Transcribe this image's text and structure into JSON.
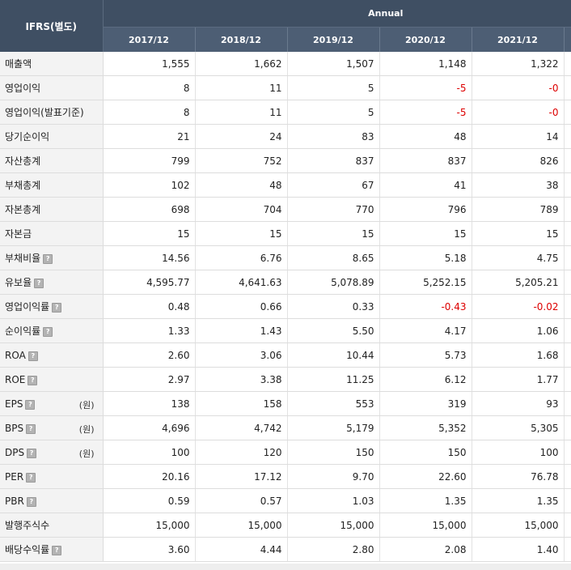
{
  "table": {
    "corner_label": "IFRS(별도)",
    "period_group": "Annual",
    "years": [
      "2017/12",
      "2018/12",
      "2019/12",
      "2020/12",
      "2021/12"
    ],
    "rows": [
      {
        "key": "revenue",
        "label": "매출액",
        "help": false,
        "unit": "",
        "values": [
          "1,555",
          "1,662",
          "1,507",
          "1,148",
          "1,322"
        ]
      },
      {
        "key": "operating-profit",
        "label": "영업이익",
        "help": false,
        "unit": "",
        "values": [
          "8",
          "11",
          "5",
          "-5",
          "-0"
        ]
      },
      {
        "key": "operating-profit-reported",
        "label": "영업이익(발표기준)",
        "help": false,
        "unit": "",
        "values": [
          "8",
          "11",
          "5",
          "-5",
          "-0"
        ]
      },
      {
        "key": "net-income",
        "label": "당기순이익",
        "help": false,
        "unit": "",
        "values": [
          "21",
          "24",
          "83",
          "48",
          "14"
        ]
      },
      {
        "key": "total-assets",
        "label": "자산총계",
        "help": false,
        "unit": "",
        "values": [
          "799",
          "752",
          "837",
          "837",
          "826"
        ]
      },
      {
        "key": "total-liabilities",
        "label": "부채총계",
        "help": false,
        "unit": "",
        "values": [
          "102",
          "48",
          "67",
          "41",
          "38"
        ]
      },
      {
        "key": "total-equity",
        "label": "자본총계",
        "help": false,
        "unit": "",
        "values": [
          "698",
          "704",
          "770",
          "796",
          "789"
        ]
      },
      {
        "key": "capital-stock",
        "label": "자본금",
        "help": false,
        "unit": "",
        "values": [
          "15",
          "15",
          "15",
          "15",
          "15"
        ]
      },
      {
        "key": "debt-ratio",
        "label": "부채비율",
        "help": true,
        "unit": "",
        "values": [
          "14.56",
          "6.76",
          "8.65",
          "5.18",
          "4.75"
        ]
      },
      {
        "key": "reserve-ratio",
        "label": "유보율",
        "help": true,
        "unit": "",
        "values": [
          "4,595.77",
          "4,641.63",
          "5,078.89",
          "5,252.15",
          "5,205.21"
        ]
      },
      {
        "key": "operating-margin",
        "label": "영업이익률",
        "help": true,
        "unit": "",
        "values": [
          "0.48",
          "0.66",
          "0.33",
          "-0.43",
          "-0.02"
        ]
      },
      {
        "key": "net-margin",
        "label": "순이익률",
        "help": true,
        "unit": "",
        "values": [
          "1.33",
          "1.43",
          "5.50",
          "4.17",
          "1.06"
        ]
      },
      {
        "key": "roa",
        "label": "ROA",
        "help": true,
        "unit": "",
        "values": [
          "2.60",
          "3.06",
          "10.44",
          "5.73",
          "1.68"
        ]
      },
      {
        "key": "roe",
        "label": "ROE",
        "help": true,
        "unit": "",
        "values": [
          "2.97",
          "3.38",
          "11.25",
          "6.12",
          "1.77"
        ]
      },
      {
        "key": "eps",
        "label": "EPS",
        "help": true,
        "unit": "(원)",
        "values": [
          "138",
          "158",
          "553",
          "319",
          "93"
        ]
      },
      {
        "key": "bps",
        "label": "BPS",
        "help": true,
        "unit": "(원)",
        "values": [
          "4,696",
          "4,742",
          "5,179",
          "5,352",
          "5,305"
        ]
      },
      {
        "key": "dps",
        "label": "DPS",
        "help": true,
        "unit": "(원)",
        "values": [
          "100",
          "120",
          "150",
          "150",
          "100"
        ]
      },
      {
        "key": "per",
        "label": "PER",
        "help": true,
        "unit": "",
        "values": [
          "20.16",
          "17.12",
          "9.70",
          "22.60",
          "76.78"
        ]
      },
      {
        "key": "pbr",
        "label": "PBR",
        "help": true,
        "unit": "",
        "values": [
          "0.59",
          "0.57",
          "1.03",
          "1.35",
          "1.35"
        ]
      },
      {
        "key": "shares-issued",
        "label": "발행주식수",
        "help": false,
        "unit": "",
        "values": [
          "15,000",
          "15,000",
          "15,000",
          "15,000",
          "15,000"
        ]
      },
      {
        "key": "dividend-yield",
        "label": "배당수익률",
        "help": true,
        "unit": "",
        "values": [
          "3.60",
          "4.44",
          "2.80",
          "2.08",
          "1.40"
        ]
      }
    ],
    "help_icon_glyph": "?",
    "colors": {
      "header_bg": "#3f4f63",
      "label_bg": "#f3f3f3",
      "negative": "#dd0000"
    }
  }
}
